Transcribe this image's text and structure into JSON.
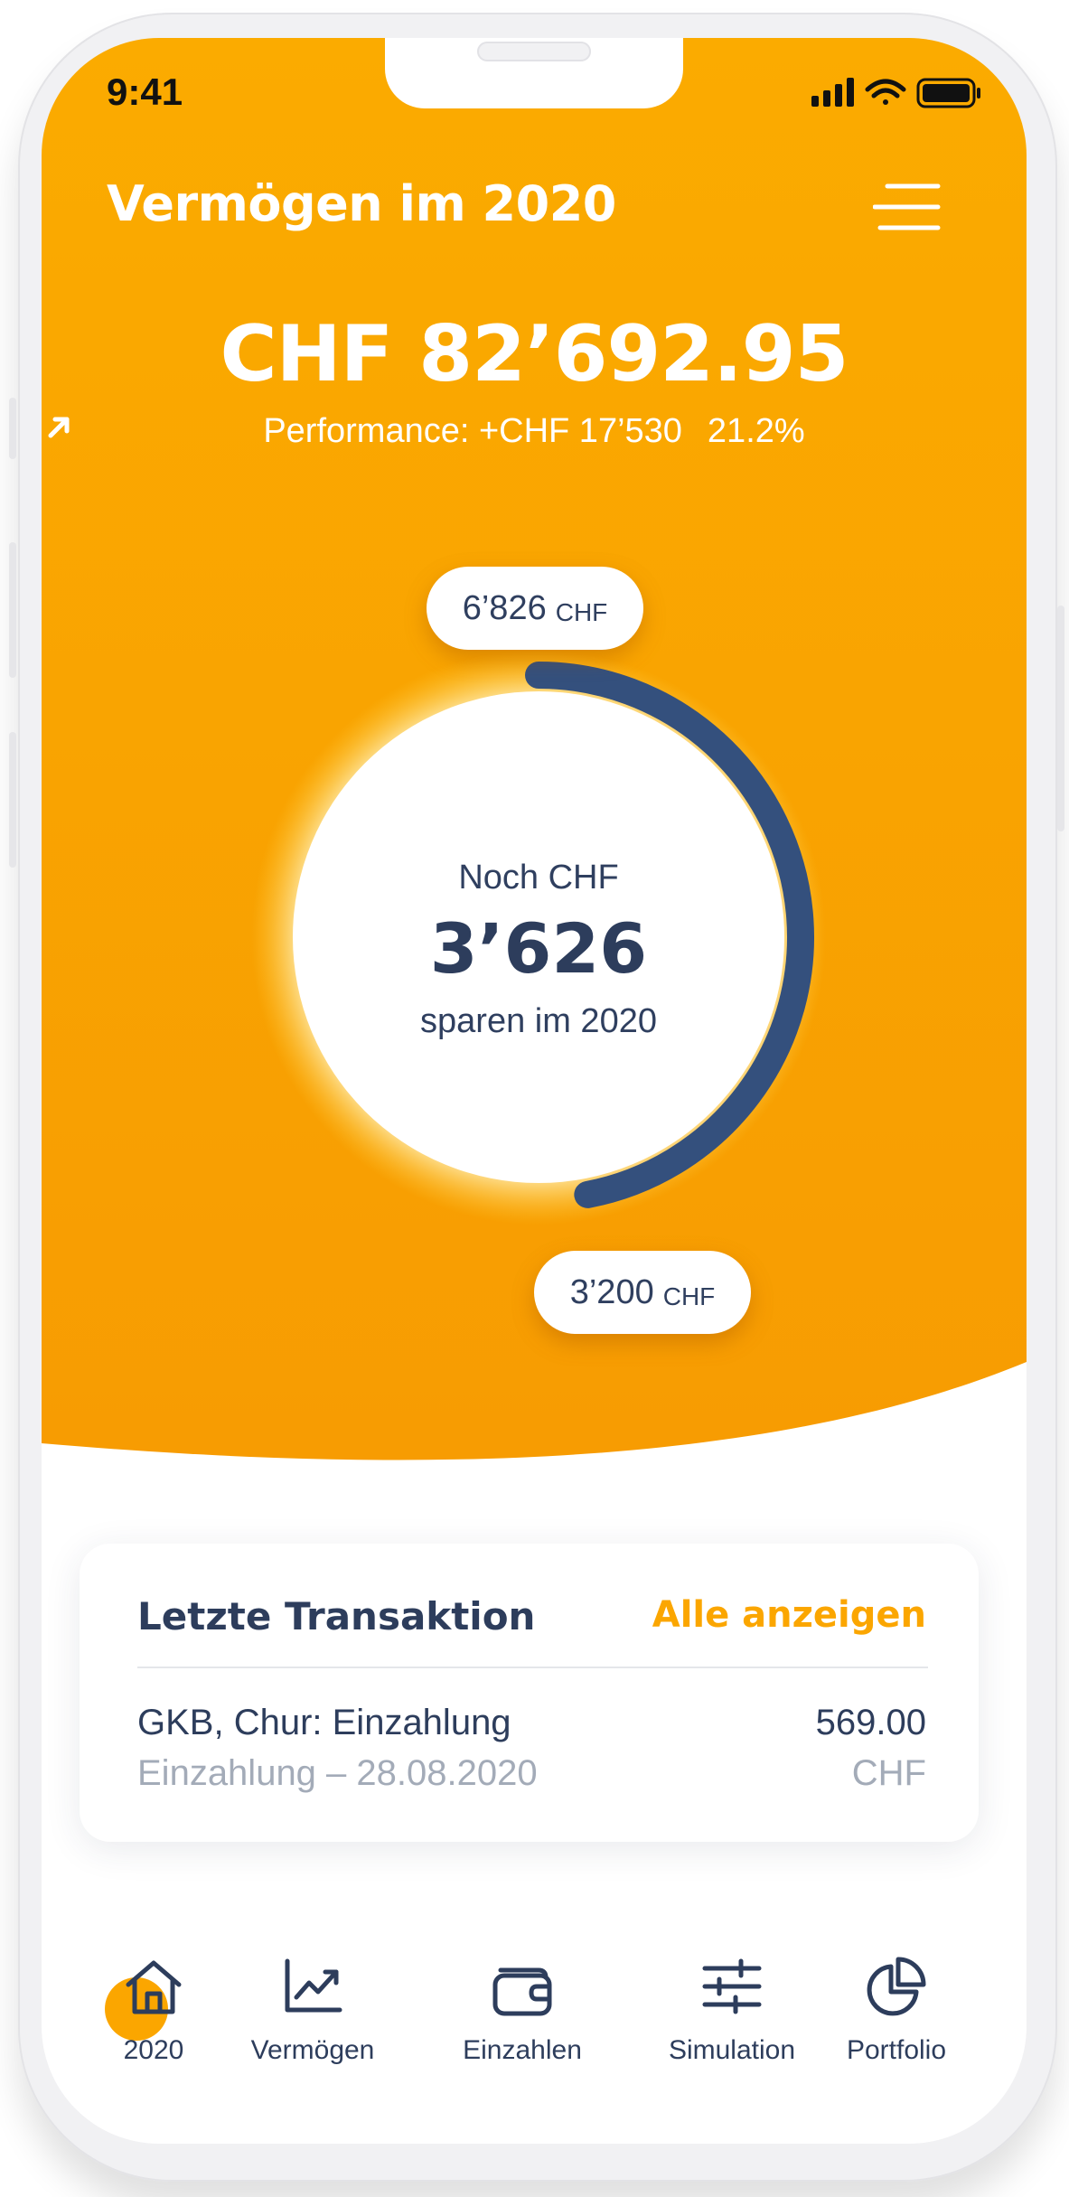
{
  "status_bar": {
    "time": "9:41"
  },
  "header": {
    "title": "Vermögen im 2020",
    "total_value": "CHF 82’692.95",
    "performance_label": "Performance: +CHF 17’530",
    "performance_percent": "21.2%",
    "performance_icon": "arrow-up-right-icon"
  },
  "savings_gauge": {
    "top_pill": {
      "amount": "6’826",
      "currency": "CHF"
    },
    "bottom_pill": {
      "amount": "3’200",
      "currency": "CHF"
    },
    "center_prefix": "Noch CHF",
    "center_amount": "3’626",
    "center_suffix": "sparen im 2020",
    "progress_fraction": 0.47
  },
  "last_transaction": {
    "title": "Letzte Transaktion",
    "show_all_label": "Alle anzeigen",
    "name": "GKB, Chur: Einzahlung",
    "subtitle": "Einzahlung – 28.08.2020",
    "amount": "569.00",
    "currency": "CHF"
  },
  "tab_bar": {
    "items": [
      {
        "label": "2020",
        "icon": "home-icon",
        "active": true
      },
      {
        "label": "Vermögen",
        "icon": "trend-chart-icon",
        "active": false
      },
      {
        "label": "Einzahlen",
        "icon": "wallet-icon",
        "active": false
      },
      {
        "label": "Simulation",
        "icon": "sliders-icon",
        "active": false
      },
      {
        "label": "Portfolio",
        "icon": "pie-chart-icon",
        "active": false
      }
    ]
  },
  "colors": {
    "accent": "#fba600",
    "accent_dark": "#f69a00",
    "navy": "#2d3d5c",
    "progress_arc": "#34507d",
    "muted_text": "#a3abb8"
  }
}
